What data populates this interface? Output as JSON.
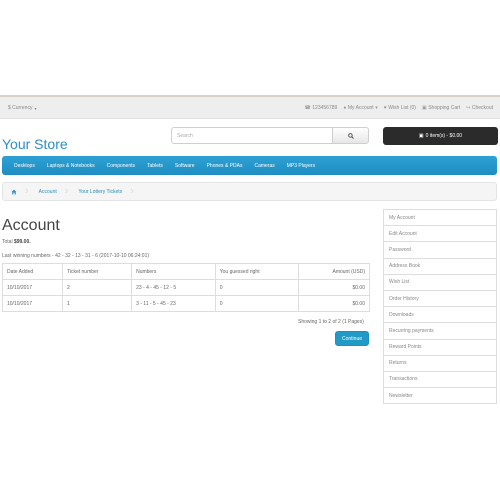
{
  "topbar": {
    "currency_label": "$ Currency",
    "phone": "123456789",
    "my_account": "My Account",
    "wish_list": "Wish List (0)",
    "shopping_cart": "Shopping Cart",
    "checkout": "Checkout"
  },
  "header": {
    "logo_text": "Your Store",
    "search_placeholder": "Search",
    "cart_label": "0 item(s) - $0.00"
  },
  "menu": {
    "items": [
      "Desktops",
      "Laptops & Notebooks",
      "Components",
      "Tablets",
      "Software",
      "Phones & PDAs",
      "Cameras",
      "MP3 Players"
    ]
  },
  "breadcrumb": {
    "items": [
      "Account",
      "Your Lottery Tickets"
    ]
  },
  "main": {
    "title": "Account",
    "total_label": "Total",
    "total_value": "$99.00.",
    "winning_numbers": "Last winning numbers - 42 - 32 - 13 - 31 - 6   (2017-10-10 06:24:01)",
    "table": {
      "headers": [
        "Date Added",
        "Ticket number",
        "Numbers",
        "You guessed right",
        "Amount (USD)"
      ],
      "rows": [
        [
          "10/10/2017",
          "2",
          "23 - 4 - 45 - 12 - 5",
          "0",
          "$0.00"
        ],
        [
          "10/10/2017",
          "1",
          "3 - 11 - 5 - 45 - 23",
          "0",
          "$0.00"
        ]
      ]
    },
    "showing_text": "Showing 1 to 2 of 2 (1 Pages)",
    "continue_label": "Continue"
  },
  "sidebar": {
    "items": [
      "My Account",
      "Edit Account",
      "Password",
      "Address Book",
      "Wish List",
      "Order History",
      "Downloads",
      "Recurring payments",
      "Reward Points",
      "Returns",
      "Transactions",
      "Newsletter"
    ]
  },
  "colors": {
    "accent": "#229ac8",
    "link": "#2c8fc6",
    "cart_bg": "#2b2b2b"
  }
}
